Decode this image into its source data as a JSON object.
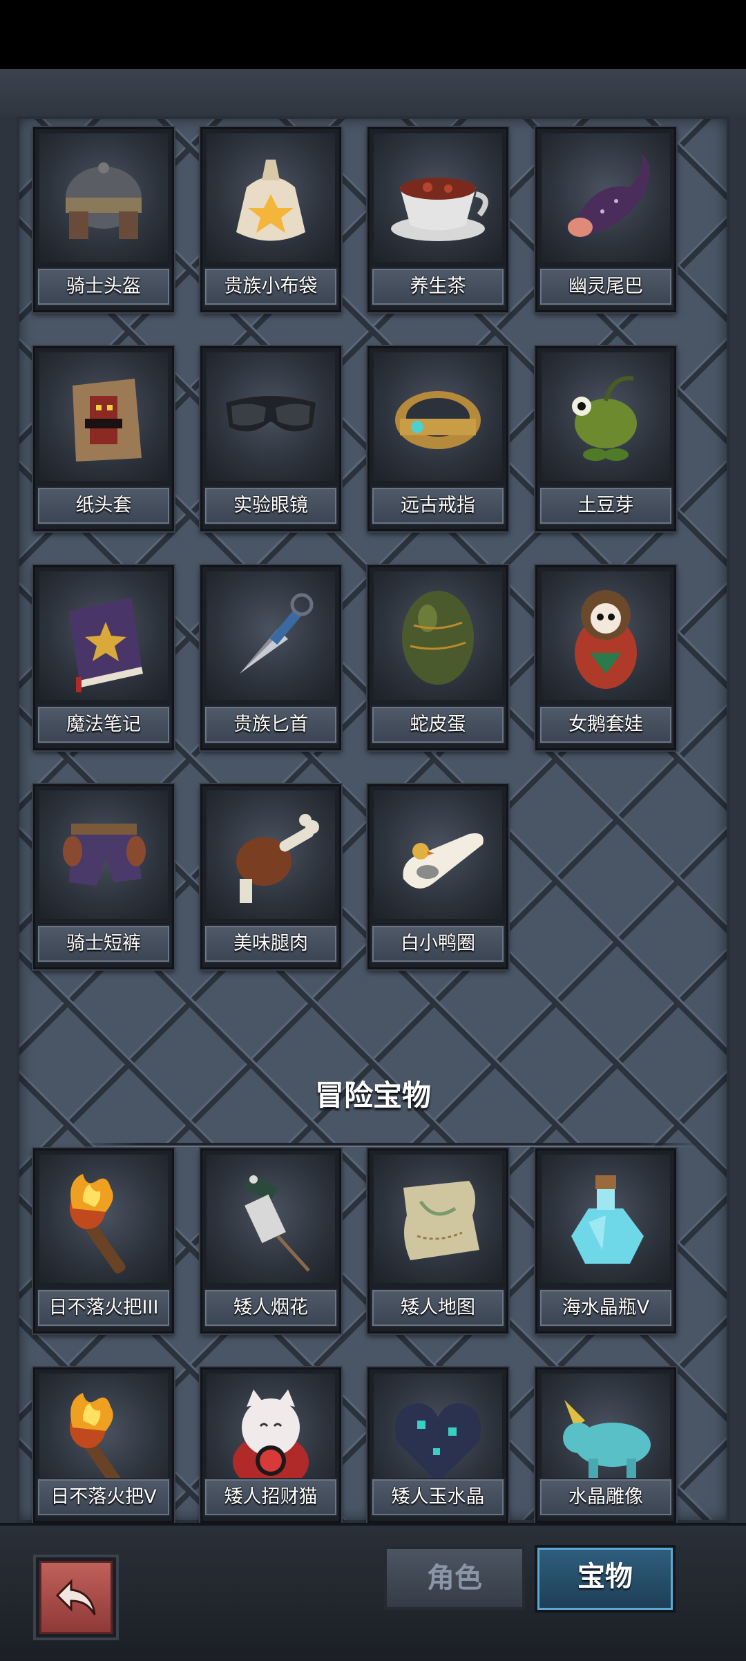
{
  "collection_items": [
    {
      "name": "骑士头盔",
      "icon": "helmet-icon"
    },
    {
      "name": "贵族小布袋",
      "icon": "pouch-icon"
    },
    {
      "name": "养生茶",
      "icon": "tea-cup-icon"
    },
    {
      "name": "幽灵尾巴",
      "icon": "ghost-tail-icon"
    },
    {
      "name": "纸头套",
      "icon": "paper-bag-icon"
    },
    {
      "name": "实验眼镜",
      "icon": "goggles-icon"
    },
    {
      "name": "远古戒指",
      "icon": "ring-icon"
    },
    {
      "name": "土豆芽",
      "icon": "sprout-icon"
    },
    {
      "name": "魔法笔记",
      "icon": "spellbook-icon"
    },
    {
      "name": "贵族匕首",
      "icon": "dagger-icon"
    },
    {
      "name": "蛇皮蛋",
      "icon": "egg-icon"
    },
    {
      "name": "女鹅套娃",
      "icon": "doll-icon"
    },
    {
      "name": "骑士短裤",
      "icon": "shorts-icon"
    },
    {
      "name": "美味腿肉",
      "icon": "meat-icon"
    },
    {
      "name": "白小鸭圈",
      "icon": "swim-ring-icon"
    }
  ],
  "adventure_section": {
    "title": "冒险宝物",
    "items": [
      {
        "name": "日不落火把III",
        "icon": "torch-icon"
      },
      {
        "name": "矮人烟花",
        "icon": "firework-icon"
      },
      {
        "name": "矮人地图",
        "icon": "map-icon"
      },
      {
        "name": "海水晶瓶V",
        "icon": "crystal-bottle-icon"
      },
      {
        "name": "日不落火把V",
        "icon": "torch-icon"
      },
      {
        "name": "矮人招财猫",
        "icon": "lucky-cat-icon"
      },
      {
        "name": "矮人玉水晶",
        "icon": "crystal-heart-icon"
      },
      {
        "name": "水晶雕像",
        "icon": "crystal-statue-icon"
      }
    ]
  },
  "bottom_bar": {
    "back_icon": "back-arrow-icon",
    "tabs": [
      {
        "label": "角色",
        "active": false
      },
      {
        "label": "宝物",
        "active": true
      }
    ]
  }
}
